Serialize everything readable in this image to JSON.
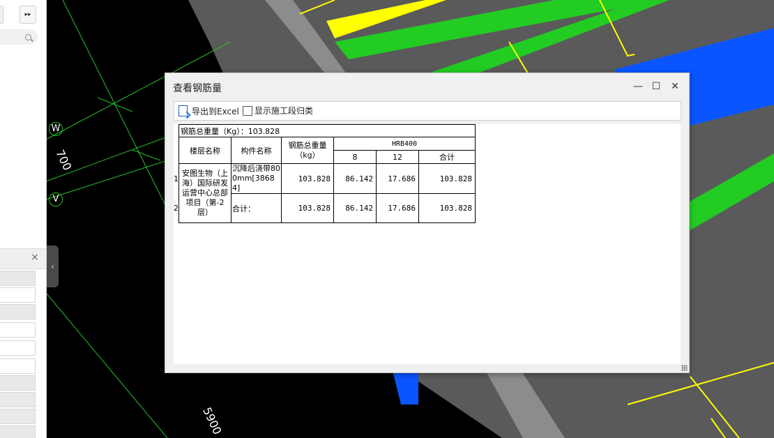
{
  "app": {
    "expander_icon": "double-chevron-right-icon",
    "search_icon": "search-icon",
    "panel_close_glyph": "×",
    "collapse_glyph": "‹"
  },
  "drawing": {
    "axis_labels": [
      "W",
      "V"
    ],
    "dimensions": [
      "700",
      "5900"
    ]
  },
  "dialog": {
    "title": "查看钢筋量",
    "controls": {
      "minimize": "—",
      "maximize": "☐",
      "close": "✕"
    },
    "toolbar": {
      "export_label": "导出到Excel",
      "show_stage_label": "显示施工段归类",
      "show_stage_checked": false
    },
    "summary": "钢筋总重量（Kg）：103.828",
    "headers": {
      "floor": "楼层名称",
      "component": "构件名称",
      "total_weight": "钢筋总重量（kg）",
      "grade": "HRB400",
      "d8": "8",
      "d12": "12",
      "subtotal": "合计"
    },
    "floor_name": "安图生物（上海）国际研发运营中心总部项目（第-2层）",
    "rows": [
      {
        "index": "1",
        "component": "沉降后浇带800mm[38684]",
        "total": "103.828",
        "d8": "86.142",
        "d12": "17.686",
        "subtotal": "103.828"
      },
      {
        "index": "2",
        "component": "合计：",
        "total": "103.828",
        "d8": "86.142",
        "d12": "17.686",
        "subtotal": "103.828"
      }
    ]
  },
  "colors": {
    "background": "#000000",
    "grid_line": "#25c025",
    "slab_gray": "#5a5a5a",
    "highlight_yellow": "#ffff00",
    "beam_green": "#22cc22",
    "slab_blue": "#0a55ff"
  }
}
